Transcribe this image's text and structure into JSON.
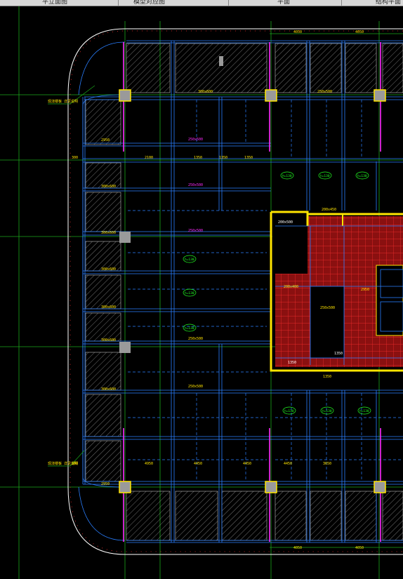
{
  "tabs": [
    "平立面图",
    "模型对应图",
    "平面",
    "结构平面"
  ],
  "colors": {
    "background": "#000000",
    "slab_outline": "#ffffff",
    "beam": "#2a7fff",
    "wall": "#ffe400",
    "column_fill": "#9a9a9a",
    "axis": "#1aa81a",
    "label_yellow": "#ffe400",
    "label_magenta": "#ff2bff",
    "label_green": "#22ff22",
    "hatch_red": "#c81e1e"
  },
  "dims": {
    "top_span_1": "4050",
    "top_span_2": "4050",
    "bottom_span_1": "4050",
    "bottom_span_2": "4050",
    "row_a": [
      "300",
      "2950",
      "2100",
      "1350",
      "1350",
      "1350",
      "2950",
      "300"
    ],
    "row_b": [
      "4950",
      "4450",
      "4450",
      "4450",
      "3650"
    ],
    "left_col": [
      "300x600",
      "300x600",
      "300x600",
      "300x600",
      "300x600",
      "300x600",
      "300x600"
    ],
    "mid_beams": [
      "250x500",
      "250x500",
      "250x500",
      "250x500",
      "250x500",
      "250x500"
    ],
    "callout_top": "现浇楼板\n详见说明",
    "callout_bottom": "现浇楼板\n详见说明"
  },
  "slab_tags": [
    "h=130",
    "h=130",
    "h=130",
    "h=130",
    "h=130",
    "h=130",
    "h=130",
    "h=130",
    "h=130",
    "h=130",
    "h=130"
  ],
  "core_labels": [
    "200x500",
    "200x450",
    "200x400",
    "250x500",
    "1350",
    "1350",
    "1350",
    "2950"
  ]
}
